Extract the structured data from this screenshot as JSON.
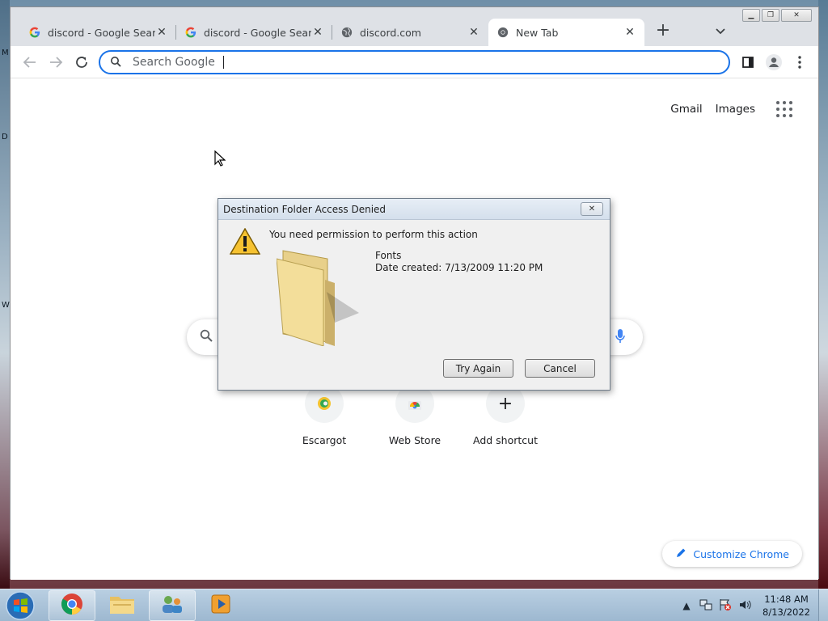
{
  "desktop": {
    "left_letters": [
      "M",
      "D",
      "W"
    ]
  },
  "browser": {
    "tabs": [
      {
        "title": "discord - Google Search",
        "favicon": "google-g-icon",
        "active": false
      },
      {
        "title": "discord - Google Search",
        "favicon": "google-g-icon",
        "active": false
      },
      {
        "title": "discord.com",
        "favicon": "globe-icon",
        "active": false
      },
      {
        "title": "New Tab",
        "favicon": "chrome-icon",
        "active": true
      }
    ],
    "new_tab_symbol": "+",
    "omnibox": {
      "placeholder": "Search Google"
    }
  },
  "ntp": {
    "toplinks": {
      "gmail": "Gmail",
      "images": "Images"
    },
    "shortcuts": [
      {
        "label": "Escargot",
        "icon": "escargot-icon"
      },
      {
        "label": "Web Store",
        "icon": "webstore-icon"
      },
      {
        "label": "Add shortcut",
        "icon": "plus-icon",
        "symbol": "+"
      }
    ],
    "customize_label": "Customize Chrome"
  },
  "dialog": {
    "title": "Destination Folder Access Denied",
    "message": "You need permission to perform this action",
    "file_name": "Fonts",
    "file_date": "Date created: 7/13/2009 11:20 PM",
    "try_again": "Try Again",
    "cancel": "Cancel"
  },
  "taskbar": {
    "clock": {
      "time": "11:48 AM",
      "date": "8/13/2022"
    }
  },
  "colors": {
    "accent": "#1a73e8",
    "tab_strip": "#dee1e6",
    "taskbar": "#a9c2d8"
  }
}
